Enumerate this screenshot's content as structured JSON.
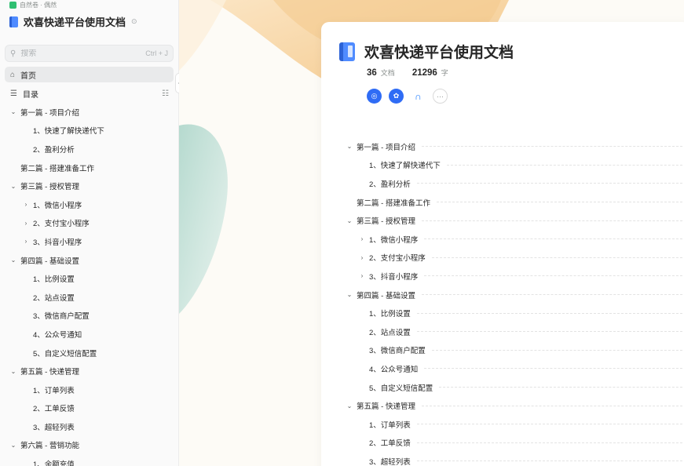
{
  "sidebar": {
    "breadcrumb": "自然卷 · 偶然",
    "book_title": "欢喜快递平台使用文档",
    "search": {
      "placeholder": "搜索",
      "shortcut": "Ctrl + J"
    },
    "nav": {
      "home": "首页",
      "toc": "目录"
    },
    "tree": [
      {
        "label": "第一篇 - 项目介绍",
        "level": 0,
        "caret": "down"
      },
      {
        "label": "1、快速了解快递代下",
        "level": 1,
        "caret": "none"
      },
      {
        "label": "2、盈利分析",
        "level": 1,
        "caret": "none"
      },
      {
        "label": "第二篇 - 搭建准备工作",
        "level": 0,
        "caret": "none"
      },
      {
        "label": "第三篇 - 授权管理",
        "level": 0,
        "caret": "down"
      },
      {
        "label": "1、微信小程序",
        "level": 1,
        "caret": "right"
      },
      {
        "label": "2、支付宝小程序",
        "level": 1,
        "caret": "right"
      },
      {
        "label": "3、抖音小程序",
        "level": 1,
        "caret": "right"
      },
      {
        "label": "第四篇 - 基础设置",
        "level": 0,
        "caret": "down"
      },
      {
        "label": "1、比例设置",
        "level": 1,
        "caret": "none"
      },
      {
        "label": "2、站点设置",
        "level": 1,
        "caret": "none"
      },
      {
        "label": "3、微信商户配置",
        "level": 1,
        "caret": "none"
      },
      {
        "label": "4、公众号通知",
        "level": 1,
        "caret": "none"
      },
      {
        "label": "5、自定义短信配置",
        "level": 1,
        "caret": "none"
      },
      {
        "label": "第五篇 - 快递管理",
        "level": 0,
        "caret": "down"
      },
      {
        "label": "1、订单列表",
        "level": 1,
        "caret": "none"
      },
      {
        "label": "2、工单反馈",
        "level": 1,
        "caret": "none"
      },
      {
        "label": "3、超轻列表",
        "level": 1,
        "caret": "none"
      },
      {
        "label": "第六篇 - 营销功能",
        "level": 0,
        "caret": "down"
      },
      {
        "label": "1、余额充值",
        "level": 1,
        "caret": "none"
      }
    ]
  },
  "main": {
    "title": "欢喜快递平台使用文档",
    "stats": {
      "docs_count": "36",
      "docs_unit": "文档",
      "words_count": "21296",
      "words_unit": "字"
    },
    "more": "···",
    "tree": [
      {
        "label": "第一篇 - 项目介绍",
        "level": 0,
        "caret": "down"
      },
      {
        "label": "1、快速了解快递代下",
        "level": 1,
        "caret": "none"
      },
      {
        "label": "2、盈利分析",
        "level": 1,
        "caret": "none"
      },
      {
        "label": "第二篇 - 搭建准备工作",
        "level": 0,
        "caret": "none"
      },
      {
        "label": "第三篇 - 授权管理",
        "level": 0,
        "caret": "down"
      },
      {
        "label": "1、微信小程序",
        "level": 1,
        "caret": "right"
      },
      {
        "label": "2、支付宝小程序",
        "level": 1,
        "caret": "right"
      },
      {
        "label": "3、抖音小程序",
        "level": 1,
        "caret": "right"
      },
      {
        "label": "第四篇 - 基础设置",
        "level": 0,
        "caret": "down"
      },
      {
        "label": "1、比例设置",
        "level": 1,
        "caret": "none"
      },
      {
        "label": "2、站点设置",
        "level": 1,
        "caret": "none"
      },
      {
        "label": "3、微信商户配置",
        "level": 1,
        "caret": "none"
      },
      {
        "label": "4、公众号通知",
        "level": 1,
        "caret": "none"
      },
      {
        "label": "5、自定义短信配置",
        "level": 1,
        "caret": "none"
      },
      {
        "label": "第五篇 - 快递管理",
        "level": 0,
        "caret": "down"
      },
      {
        "label": "1、订单列表",
        "level": 1,
        "caret": "none"
      },
      {
        "label": "2、工单反馈",
        "level": 1,
        "caret": "none"
      },
      {
        "label": "3、超轻列表",
        "level": 1,
        "caret": "none"
      }
    ]
  },
  "colors": {
    "accent": "#2f6cf5",
    "sidebar_bg": "#fafafa",
    "art_orange": "#f7d3a3",
    "art_teal": "#b9ddd3"
  }
}
